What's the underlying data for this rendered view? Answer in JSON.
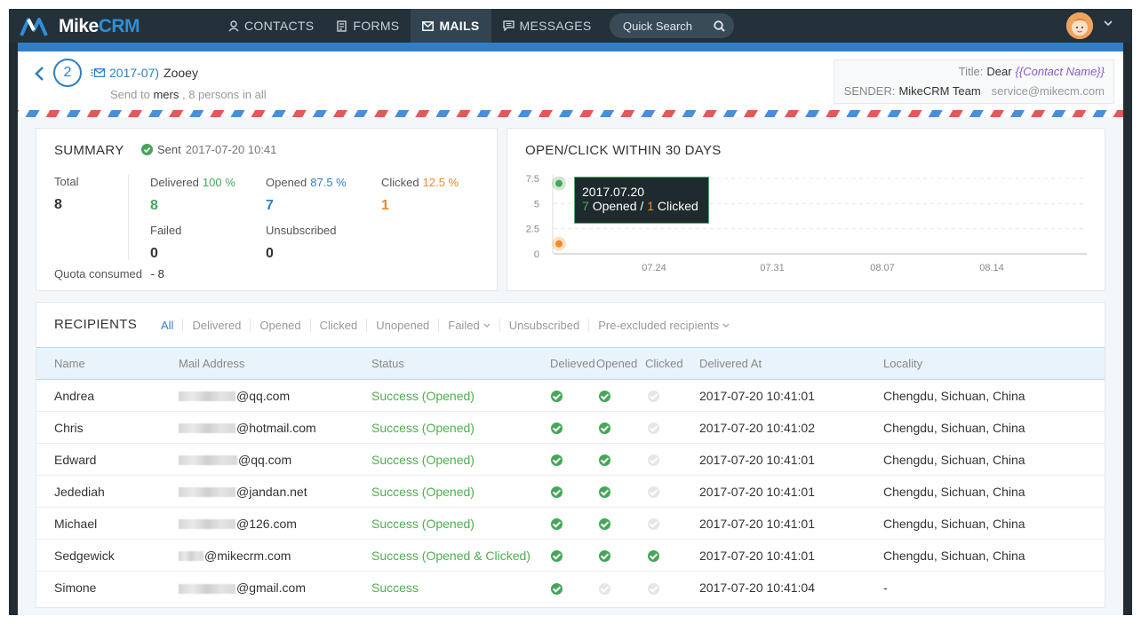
{
  "app": {
    "logo_mike": "Mike",
    "logo_crm": "CRM"
  },
  "nav": [
    {
      "label": "CONTACTS",
      "icon": "user-icon"
    },
    {
      "label": "FORMS",
      "icon": "form-icon"
    },
    {
      "label": "MAILS",
      "icon": "mail-icon",
      "active": true
    },
    {
      "label": "MESSAGES",
      "icon": "message-icon"
    }
  ],
  "search": {
    "placeholder": "Quick Search"
  },
  "mail": {
    "step": "2",
    "date": "2017-07)",
    "name": "Zooey",
    "send_to_prefix": "Send to",
    "send_to_group": "mers",
    "send_to_suffix": ", 8 persons in all",
    "title_label": "Title:",
    "title_value": "Dear",
    "title_tag": "{{Contact Name}}",
    "sender_label": "SENDER:",
    "sender_name": "MikeCRM Team",
    "sender_email": "service@mikecm.com"
  },
  "summary": {
    "title": "SUMMARY",
    "sent_label": "Sent",
    "sent_time": "2017-07-20 10:41",
    "total_label": "Total",
    "total": "8",
    "delivered_label": "Delivered",
    "delivered_pct": "100 %",
    "delivered": "8",
    "opened_label": "Opened",
    "opened_pct": "87.5 %",
    "opened": "7",
    "clicked_label": "Clicked",
    "clicked_pct": "12.5 %",
    "clicked": "1",
    "failed_label": "Failed",
    "failed": "0",
    "unsub_label": "Unsubscribed",
    "unsub": "0",
    "quota_label": "Quota consumed",
    "quota": "- 8"
  },
  "chart_data": {
    "type": "line",
    "title": "OPEN/CLICK WITHIN 30 DAYS",
    "y_ticks": [
      "7.5",
      "5",
      "2.5",
      "0"
    ],
    "x_ticks": [
      "07.24",
      "07.31",
      "08.07",
      "08.14"
    ],
    "ylim": [
      0,
      7.5
    ],
    "series": [
      {
        "name": "Opened",
        "color": "#45a65a",
        "points": [
          {
            "x": "2017.07.20",
            "y": 7
          }
        ]
      },
      {
        "name": "Clicked",
        "color": "#f08a24",
        "points": [
          {
            "x": "2017.07.20",
            "y": 1
          }
        ]
      }
    ],
    "tooltip": {
      "date": "2017.07.20",
      "opened": "7",
      "opened_label": "Opened /",
      "clicked": "1",
      "clicked_label": "Clicked"
    }
  },
  "recipients": {
    "title": "RECIPIENTS",
    "filters": [
      "All",
      "Delivered",
      "Opened",
      "Clicked",
      "Unopened",
      "Failed",
      "Unsubscribed",
      "Pre-excluded recipients"
    ],
    "columns": [
      "Name",
      "Mail Address",
      "Status",
      "Delieved",
      "Opened",
      "Clicked",
      "Delivered At",
      "Locality"
    ],
    "rows": [
      {
        "name": "Andrea",
        "mail": "@qq.com",
        "status": "Success (Opened)",
        "d": true,
        "o": true,
        "c": false,
        "at": "2017-07-20 10:41:01",
        "loc": "Chengdu, Sichuan, China"
      },
      {
        "name": "Chris",
        "mail": "@hotmail.com",
        "status": "Success (Opened)",
        "d": true,
        "o": true,
        "c": false,
        "at": "2017-07-20 10:41:02",
        "loc": "Chengdu, Sichuan, China"
      },
      {
        "name": "Edward",
        "mail": "@qq.com",
        "status": "Success (Opened)",
        "d": true,
        "o": true,
        "c": false,
        "at": "2017-07-20 10:41:01",
        "loc": "Chengdu, Sichuan, China"
      },
      {
        "name": "Jedediah",
        "mail": "@jandan.net",
        "status": "Success (Opened)",
        "d": true,
        "o": true,
        "c": false,
        "at": "2017-07-20 10:41:01",
        "loc": "Chengdu, Sichuan, China"
      },
      {
        "name": "Michael",
        "mail": "@126.com",
        "status": "Success (Opened)",
        "d": true,
        "o": true,
        "c": false,
        "at": "2017-07-20 10:41:01",
        "loc": "Chengdu, Sichuan, China"
      },
      {
        "name": "Sedgewick",
        "mail": "@mikecrm.com",
        "status": "Success (Opened & Clicked)",
        "d": true,
        "o": true,
        "c": true,
        "at": "2017-07-20 10:41:01",
        "loc": "Chengdu, Sichuan, China"
      },
      {
        "name": "Simone",
        "mail": "@gmail.com",
        "status": "Success",
        "d": true,
        "o": false,
        "c": false,
        "at": "2017-07-20 10:41:04",
        "loc": "-"
      }
    ]
  }
}
